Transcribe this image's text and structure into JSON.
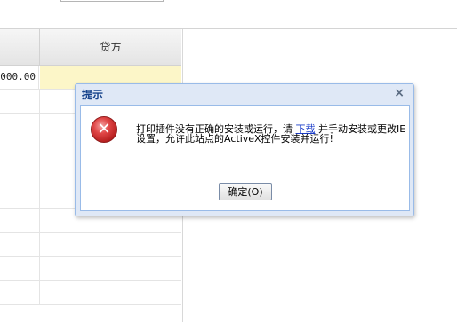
{
  "grid": {
    "header": {
      "col2_label": "贷方"
    },
    "first_row": {
      "amount": "000.00"
    }
  },
  "dialog": {
    "title": "提示",
    "close_glyph": "×",
    "message_before_link": "打印插件没有正确的安装或运行，请 ",
    "link_text": "下载",
    "message_after_link": " 并手动安装或更改IE设置，允许此站点的ActiveX控件安装并运行!",
    "ok_label": "确定(O)",
    "icon": "error-icon"
  },
  "colors": {
    "dialog_title": "#15428b",
    "dialog_border": "#99bbe8",
    "highlight_cell": "#fcf6c8",
    "link": "#1a3cc9",
    "error": "#e04646"
  }
}
